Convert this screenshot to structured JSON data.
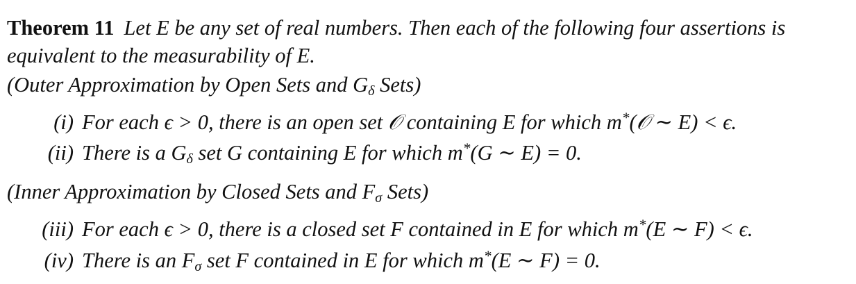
{
  "theorem": {
    "label": "Theorem 11",
    "statement_line1": "Let E be any set of real numbers. Then each of the following four assertions is",
    "statement_line2": "equivalent to the measurability of E."
  },
  "outer": {
    "heading_pre": "(Outer Approximation by Open Sets and G",
    "heading_sub": "δ",
    "heading_post": " Sets)",
    "items": [
      {
        "index": "(i)",
        "text_pre": "For each ϵ > 0, there is an open set 𝒪 containing E for which m",
        "sup": "*",
        "text_post": "(𝒪 ∼ E) < ϵ."
      },
      {
        "index": "(ii)",
        "text_pre": "There is a G",
        "sub": "δ",
        "text_mid": " set G containing E for which m",
        "sup": "*",
        "text_post": "(G ∼ E) = 0."
      }
    ]
  },
  "inner": {
    "heading_pre": "(Inner Approximation by Closed Sets and F",
    "heading_sub": "σ",
    "heading_post": " Sets)",
    "items": [
      {
        "index": "(iii)",
        "text_pre": "For each ϵ > 0, there is a closed set F contained in E for which m",
        "sup": "*",
        "text_post": "(E ∼ F) < ϵ."
      },
      {
        "index": "(iv)",
        "text_pre": "There is an F",
        "sub": "σ",
        "text_mid": " set F contained in E for which m",
        "sup": "*",
        "text_post": "(E ∼ F) = 0."
      }
    ]
  }
}
